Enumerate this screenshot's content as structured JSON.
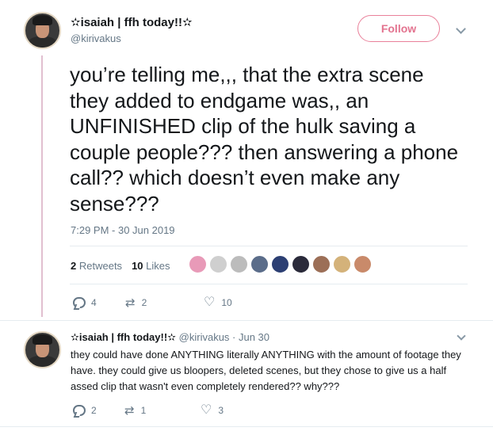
{
  "tweet": {
    "display_name": "✫isaiah | ffh today!!✫",
    "handle": "@kirivakus",
    "follow_label": "Follow",
    "text": "you’re telling me,,, that the extra scene they added to endgame was,, an UNFINISHED clip of the hulk saving a couple people??? then answering a phone call?? which doesn’t even make any sense???",
    "timestamp": "7:29 PM - 30 Jun 2019",
    "retweets_count": "2",
    "retweets_label": "Retweets",
    "likes_count": "10",
    "likes_label": "Likes",
    "liker_colors": [
      "#e89ab8",
      "#cfcfcf",
      "#bcbcbc",
      "#5b6d8a",
      "#2c3f73",
      "#2a2a3a",
      "#9c6f57",
      "#d4b27a",
      "#c98a6a"
    ],
    "actions": {
      "replies": "4",
      "retweets": "2",
      "likes": "10"
    }
  },
  "reply": {
    "display_name": "✫isaiah | ffh today!!✫",
    "meta": "@kirivakus · Jun 30",
    "text": "they could have done ANYTHING literally ANYTHING with the amount of footage they have. they could give us bloopers, deleted scenes, but they chose to give us a half assed clip that wasn't even completely rendered?? why???",
    "actions": {
      "replies": "2",
      "retweets": "1",
      "likes": "3"
    }
  },
  "colors": {
    "accent": "#e3738f",
    "muted": "#657786",
    "thread_line": "#e1bfd0"
  }
}
